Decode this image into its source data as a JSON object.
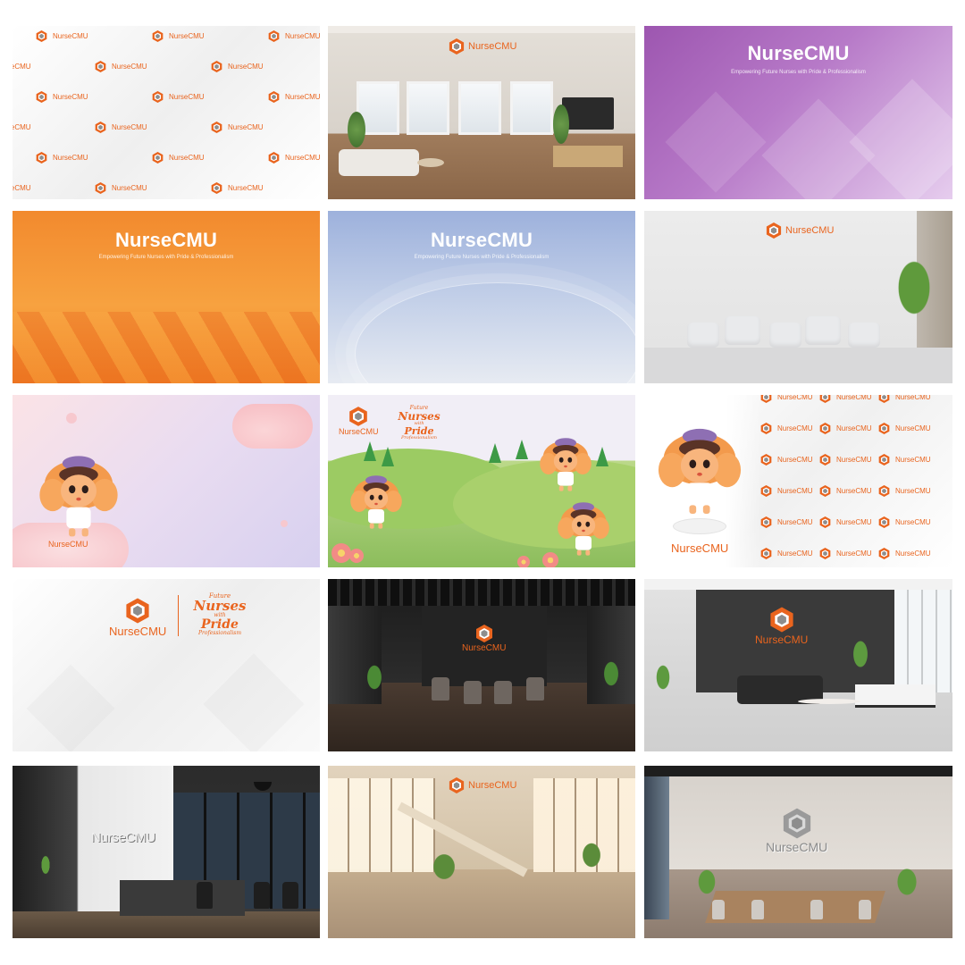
{
  "brand": {
    "name": "NurseCMU",
    "tagline": "Empowering Future Nurses with Pride & Professionalism",
    "slogan_top": "Future",
    "slogan_main_1": "Nurses",
    "slogan_main_2": "Pride",
    "slogan_with": "with",
    "slogan_bottom": "Professionalism",
    "accent_color": "#e9641e",
    "purple_color": "#a15fb6",
    "orange_color": "#f39a34",
    "blue_color": "#9fb4d9"
  },
  "tiles": [
    {
      "id": "pattern-white",
      "title": "NurseCMU"
    },
    {
      "id": "living-room",
      "title": "NurseCMU"
    },
    {
      "id": "purple-banner",
      "title": "NurseCMU",
      "subtitle": "Empowering Future Nurses with Pride & Professionalism"
    },
    {
      "id": "orange-banner",
      "title": "NurseCMU",
      "subtitle": "Empowering Future Nurses with Pride & Professionalism"
    },
    {
      "id": "blue-banner",
      "title": "NurseCMU",
      "subtitle": "Empowering Future Nurses with Pride & Professionalism"
    },
    {
      "id": "sofa-room",
      "title": "NurseCMU"
    },
    {
      "id": "mascot-clouds",
      "title": "NurseCMU"
    },
    {
      "id": "mascot-hills",
      "title": "NurseCMU"
    },
    {
      "id": "mascot-pattern",
      "title": "NurseCMU"
    },
    {
      "id": "logo-slogan-white",
      "title": "NurseCMU"
    },
    {
      "id": "dark-meeting-room",
      "title": "NurseCMU"
    },
    {
      "id": "grey-lounge",
      "title": "NurseCMU"
    },
    {
      "id": "silver-office",
      "title": "NurseCMU"
    },
    {
      "id": "sunlit-hall",
      "title": "NurseCMU"
    },
    {
      "id": "concrete-boardroom",
      "title": "NurseCMU"
    }
  ]
}
